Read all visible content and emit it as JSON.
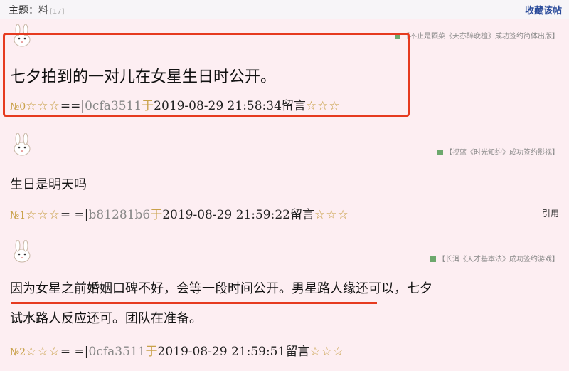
{
  "topbar": {
    "subject_label": "主题：料",
    "subject_count": "[17]",
    "favorite_label": "收藏该帖"
  },
  "posts": [
    {
      "signature": "【不止是颗菜《天亦醉晚檀》成功签约简体出版】",
      "content": "七夕拍到的一对儿在女星生日时公开。",
      "footer": {
        "floor": "№0",
        "stars_left": "☆☆☆",
        "separator": "==|",
        "user": "0cfa3511",
        "yu": "于",
        "datetime": "2019-08-29 21:58:34",
        "action": "留言",
        "stars_right": "☆☆☆"
      }
    },
    {
      "signature": "【视蓝《时光知约》成功签约影视】",
      "content": "生日是明天吗",
      "footer": {
        "floor": "№1",
        "stars_left": "☆☆☆",
        "separator": "= =|",
        "user": "b81281b6",
        "yu": "于",
        "datetime": "2019-08-29 21:59:22",
        "action": "留言",
        "stars_right": "☆☆☆"
      },
      "quote": "引用"
    },
    {
      "signature": "【长洱《天才基本法》成功签约游戏】",
      "content_line1": "因为女星之前婚姻口碑不好，会等一段时间公开。男星路人缘还可以，七夕",
      "content_line2": "试水路人反应还可。团队在准备。",
      "footer": {
        "floor": "№2",
        "stars_left": "☆☆☆",
        "separator": "= =|",
        "user": "0cfa3511",
        "yu": "于",
        "datetime": "2019-08-29 21:59:51",
        "action": "留言",
        "stars_right": "☆☆☆"
      }
    }
  ],
  "colors": {
    "background": "#fdeef2",
    "highlight": "#e63a1f",
    "gold": "#c9a14a",
    "link_blue": "#2b4c9b"
  },
  "icons": {
    "avatar": "rabbit-avatar-icon"
  }
}
